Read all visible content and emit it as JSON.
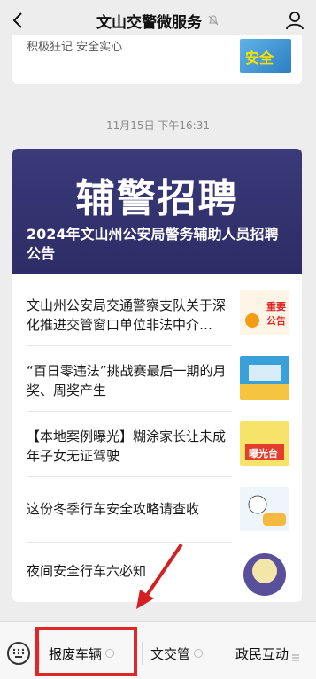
{
  "header": {
    "title": "文山交警微服务",
    "back_icon": "chevron-left-icon",
    "user_icon": "user-icon",
    "mute_icon": "mute-bell-icon"
  },
  "top_card": {
    "text": "积极狂记 安全实心",
    "thumb_text": "安全"
  },
  "timestamp": "11月15日 下午16:31",
  "banner": {
    "headline": "辅警招聘",
    "title": "2024年文山州公安局警务辅助人员招聘公告"
  },
  "articles": [
    {
      "title": "文山州公安局交通警察支队关于深化推进交管窗口单位非法中介…",
      "thumb_label": "重要公告"
    },
    {
      "title": "“百日零违法”挑战赛最后一期的月奖、周奖产生",
      "thumb_label": ""
    },
    {
      "title": "【本地案例曝光】糊涂家长让未成年子女无证驾驶",
      "thumb_label": "曝光台"
    },
    {
      "title": "这份冬季行车安全攻略请查收",
      "thumb_label": ""
    },
    {
      "title": "夜间安全行车六必知",
      "thumb_label": ""
    }
  ],
  "bottom_menu": [
    {
      "label": "报废车辆"
    },
    {
      "label": "文交管"
    },
    {
      "label": "政民互动"
    }
  ],
  "colors": {
    "banner": "#2d2c66",
    "highlight": "#e02727"
  }
}
